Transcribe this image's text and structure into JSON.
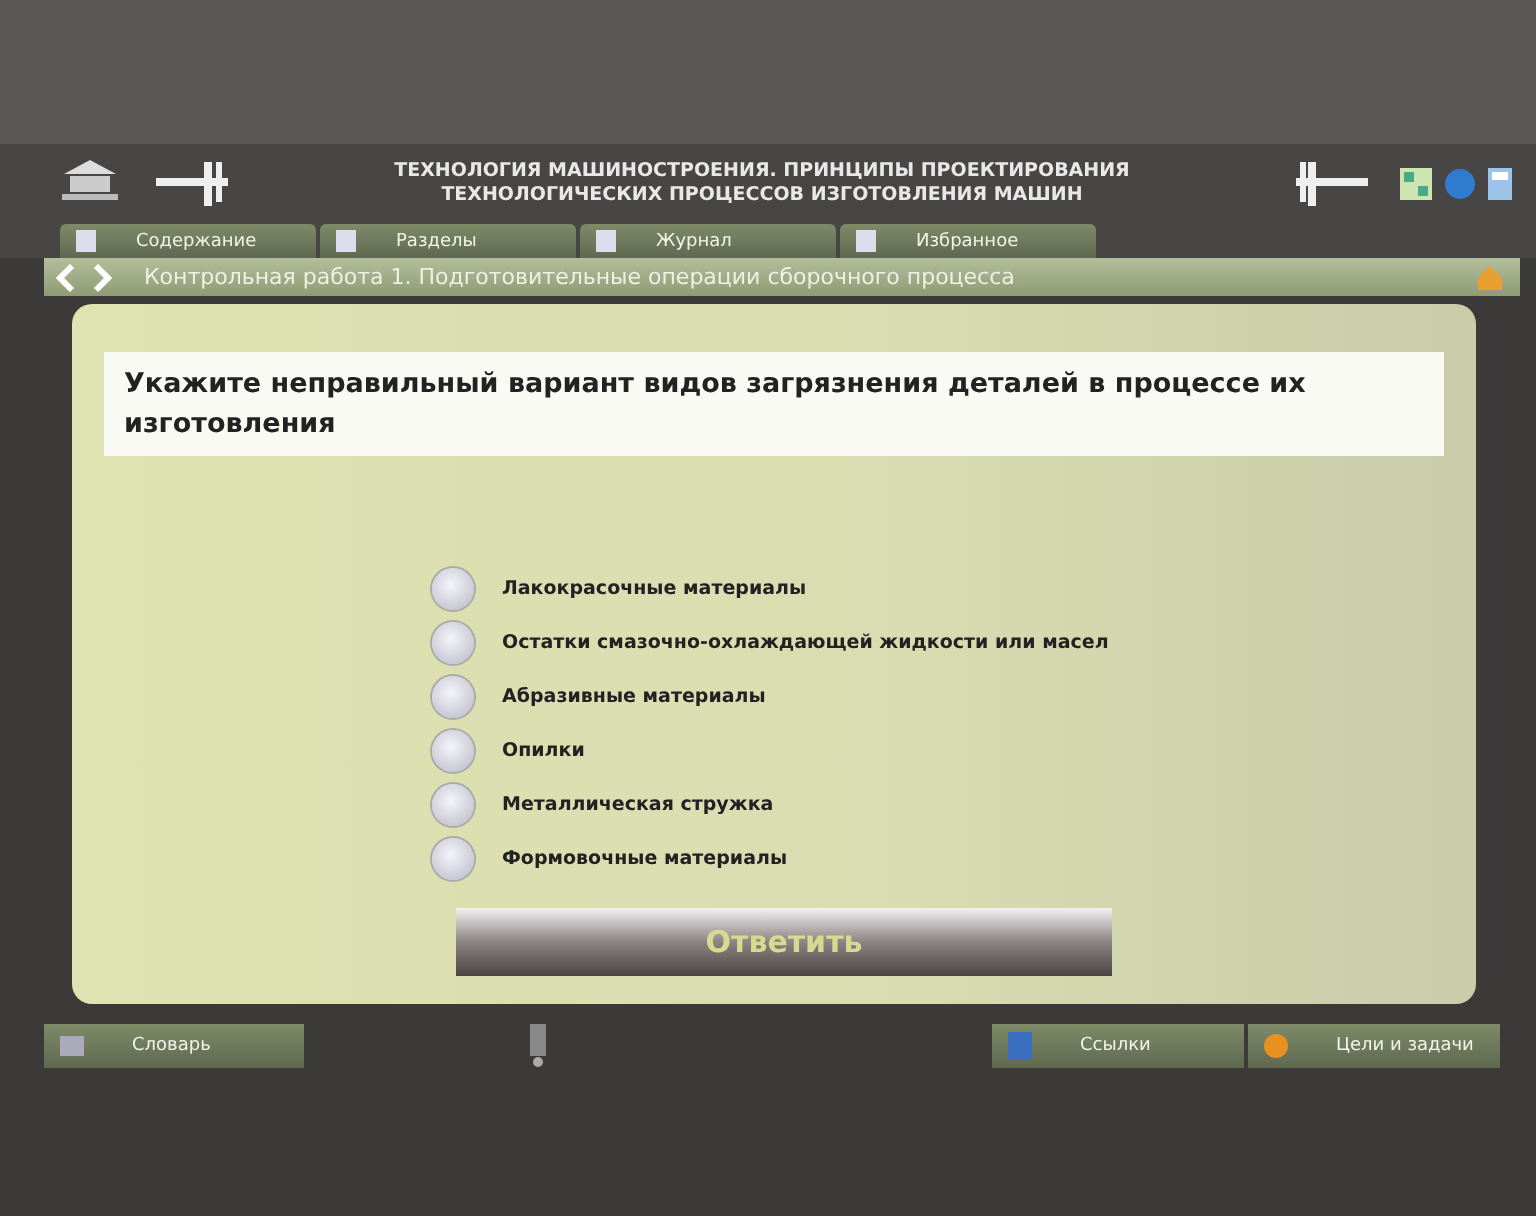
{
  "header": {
    "title_line1": "ТЕХНОЛОГИЯ МАШИНОСТРОЕНИЯ. ПРИНЦИПЫ ПРОЕКТИРОВАНИЯ",
    "title_line2": "ТЕХНОЛОГИЧЕСКИХ ПРОЦЕССОВ ИЗГОТОВЛЕНИЯ МАШИН"
  },
  "tabs": [
    {
      "label": "Содержание",
      "selected": false
    },
    {
      "label": "Разделы",
      "selected": false
    },
    {
      "label": "Журнал",
      "selected": false
    },
    {
      "label": "Избранное",
      "selected": false
    }
  ],
  "breadcrumb": "Контрольная работа 1. Подготовительные операции сборочного процесса",
  "question": "Укажите неправильный вариант видов загрязнения деталей в процессе их изготовления",
  "options": [
    {
      "label": "Лакокрасочные материалы",
      "selected": false
    },
    {
      "label": "Остатки смазочно-охлаждающей жидкости или масел",
      "selected": false
    },
    {
      "label": "Абразивные материалы",
      "selected": false
    },
    {
      "label": "Опилки",
      "selected": false
    },
    {
      "label": "Металлическая стружка",
      "selected": false
    },
    {
      "label": "Формовочные материалы",
      "selected": false
    }
  ],
  "answer_button": "Ответить",
  "footer": {
    "left": "Словарь",
    "links": "Ссылки",
    "goals": "Цели и задачи"
  }
}
